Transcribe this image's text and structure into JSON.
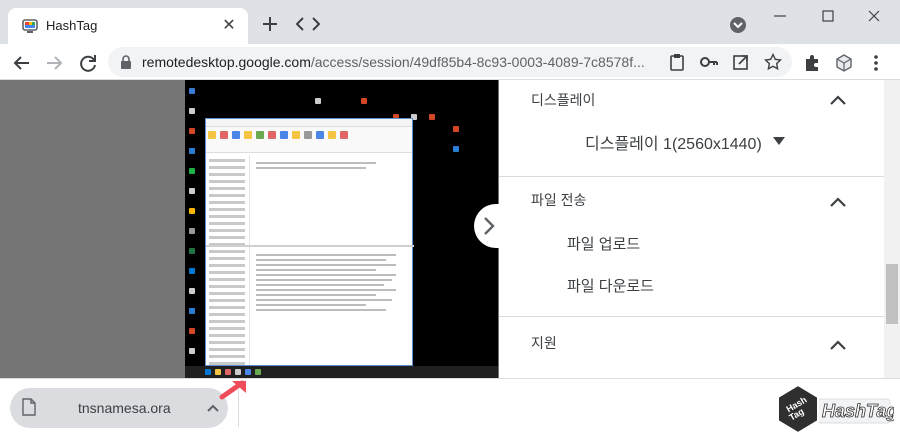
{
  "tab": {
    "title": "HashTag",
    "close_label": "✕",
    "favicon": "remote-desktop-icon"
  },
  "window": {
    "minimize_icon": "minimize-icon",
    "maximize_icon": "maximize-icon",
    "close_icon": "close-icon"
  },
  "toolbar": {
    "url_host": "remotedesktop.google.com",
    "url_path": "/access/session/49df85b4-8c93-0003-4089-7c8578f..."
  },
  "side_panel": {
    "display_section": {
      "title": "디스플레이",
      "selected": "디스플레이 1(2560x1440)"
    },
    "file_section": {
      "title": "파일 전송",
      "upload": "파일 업로드",
      "download": "파일 다운로드"
    },
    "support_section": {
      "title": "지원"
    }
  },
  "download": {
    "filename": "tnsnamesa.ora"
  },
  "logo": {
    "text": "HashTag",
    "badge": "Hash Tag"
  },
  "colors": {
    "accent_pointer": "#ee4c5a",
    "panel_text": "#3c4043",
    "remote_bg": "#000000"
  }
}
